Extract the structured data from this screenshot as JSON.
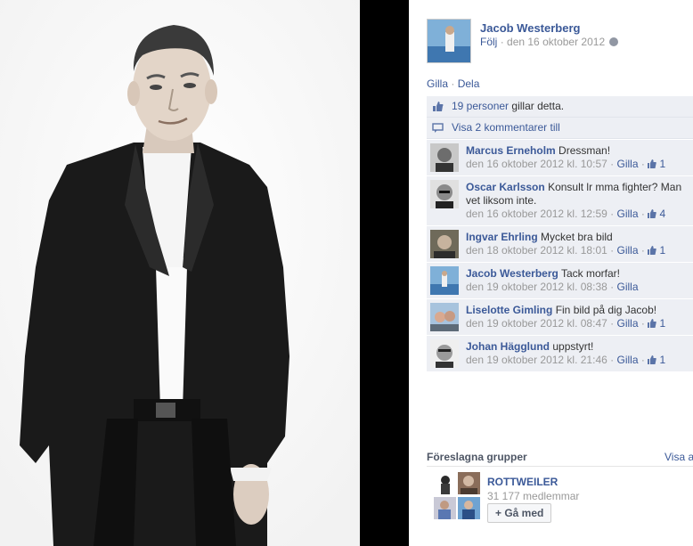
{
  "post": {
    "owner_name": "Jacob Westerberg",
    "follow_label": "Följ",
    "date": "den 16 oktober 2012"
  },
  "actions": {
    "like_label": "Gilla",
    "share_label": "Dela"
  },
  "likes": {
    "count_text": "19 personer",
    "suffix": "gillar detta."
  },
  "view_more": "Visa 2 kommentarer till",
  "comments": [
    {
      "author": "Marcus Erneholm",
      "text": "Dressman!",
      "time": "den 16 oktober 2012 kl. 10:57",
      "like_label": "Gilla",
      "likes": "1"
    },
    {
      "author": "Oscar Karlsson",
      "text": "Konsult lr mma fighter? Man vet liksom inte.",
      "time": "den 16 oktober 2012 kl. 12:59",
      "like_label": "Gilla",
      "likes": "4"
    },
    {
      "author": "Ingvar Ehrling",
      "text": "Mycket bra bild",
      "time": "den 18 oktober 2012 kl. 18:01",
      "like_label": "Gilla",
      "likes": "1"
    },
    {
      "author": "Jacob Westerberg",
      "text": "Tack morfar!",
      "time": "den 19 oktober 2012 kl. 08:38",
      "like_label": "Gilla",
      "likes": ""
    },
    {
      "author": "Liselotte Gimling",
      "text": "Fin bild på dig Jacob!",
      "time": "den 19 oktober 2012 kl. 08:47",
      "like_label": "Gilla",
      "likes": "1"
    },
    {
      "author": "Johan Hägglund",
      "text": "uppstyrt!",
      "time": "den 19 oktober 2012 kl. 21:46",
      "like_label": "Gilla",
      "likes": "1"
    }
  ],
  "suggested": {
    "header": "Föreslagna grupper",
    "see_all": "Visa a",
    "group_name": "ROTTWEILER",
    "members": "31 177 medlemmar",
    "join_label": "+ Gå med"
  },
  "colors": {
    "link": "#3b5998",
    "ufi_bg": "#edeff4",
    "separator_bg": "#000000"
  }
}
